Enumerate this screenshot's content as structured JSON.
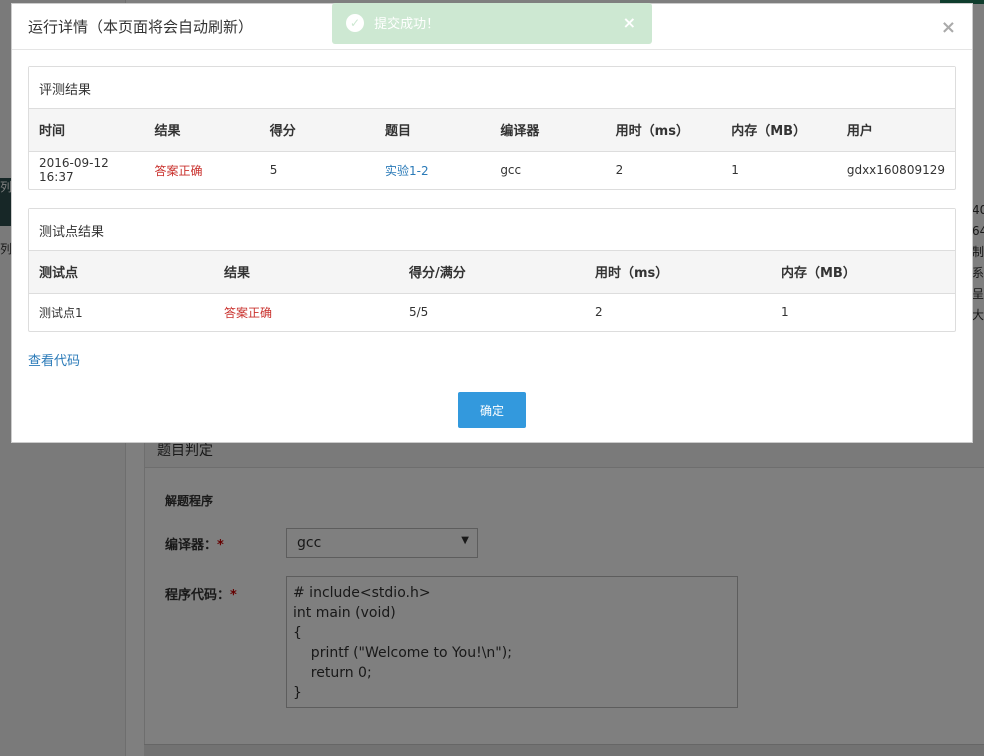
{
  "modal": {
    "title": "运行详情（本页面将会自动刷新）",
    "close_glyph": "×",
    "eval_panel": {
      "title": "评测结果",
      "columns": [
        "时间",
        "结果",
        "得分",
        "题目",
        "编译器",
        "用时（ms）",
        "内存（MB）",
        "用户"
      ],
      "row": {
        "time": "2016-09-12 16:37",
        "result": "答案正确",
        "score": "5",
        "problem": "实验1-2",
        "compiler": "gcc",
        "time_ms": "2",
        "memory_mb": "1",
        "user": "gdxx160809129"
      }
    },
    "testpoint_panel": {
      "title": "测试点结果",
      "columns": [
        "测试点",
        "结果",
        "得分/满分",
        "用时（ms）",
        "内存（MB）"
      ],
      "row": {
        "name": "测试点1",
        "result": "答案正确",
        "score": "5/5",
        "time_ms": "2",
        "memory_mb": "1"
      }
    },
    "view_code_label": "查看代码",
    "ok_label": "确定"
  },
  "toast": {
    "message": "提交成功！",
    "icon_glyph": "✓",
    "close_glyph": "×"
  },
  "background": {
    "panel_title": "题目判定",
    "section_title": "解题程序",
    "compiler_label": "编译器：",
    "compiler_value": "gcc",
    "code_label": "程序代码：",
    "required_mark": "*",
    "code": "# include<stdio.h>\nint main (void)\n{\n    printf (\"Welcome to You!\\n\");\n    return 0;\n}",
    "left_text_1": "列",
    "left_text_2": "列",
    "right_texts": [
      "40",
      "64",
      "制",
      "系",
      "呈",
      "大"
    ]
  },
  "colors": {
    "accent": "#3399dd",
    "success_toast": "#cde8d2",
    "error_text": "#c9302c",
    "link": "#2a7ab8"
  }
}
